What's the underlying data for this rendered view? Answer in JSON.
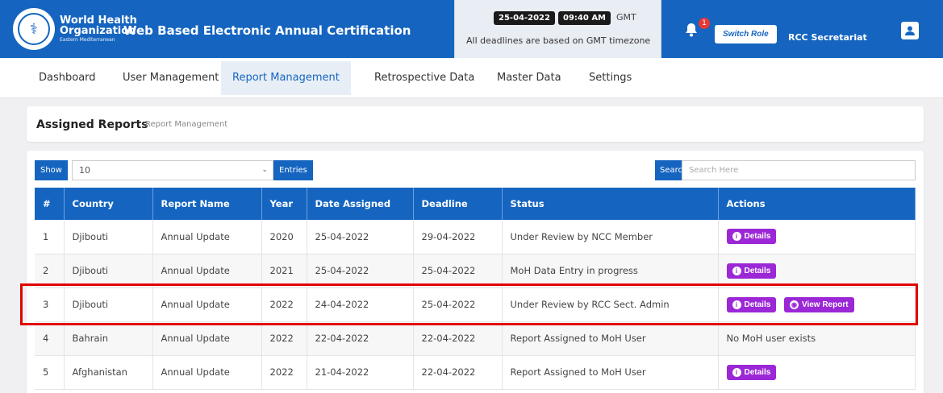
{
  "header": {
    "org_line1": "World Health",
    "org_line2": "Organization",
    "org_line3": "Eastern Mediterranean",
    "app_title": "Web Based Electronic Annual Certification",
    "date": "25-04-2022",
    "time": "09:40 AM",
    "tz": "GMT",
    "tz_note": "All deadlines are based on GMT timezone",
    "notification_count": "1",
    "switch_role": "Switch Role",
    "user_name": "RCC Secretariat",
    "brand_color": "#1565c0"
  },
  "nav": {
    "items": [
      {
        "label": "Dashboard"
      },
      {
        "label": "User Management"
      },
      {
        "label": "Report Management"
      },
      {
        "label": "Retrospective Data"
      },
      {
        "label": "Master Data"
      },
      {
        "label": "Settings"
      }
    ],
    "active": "Report Management"
  },
  "breadcrumb": {
    "title": "Assigned Reports",
    "sub": "Report Management"
  },
  "table_controls": {
    "show_label": "Show",
    "entries_value": "10",
    "entries_label": "Entries",
    "search_label": "Search:",
    "search_placeholder": "Search Here"
  },
  "table": {
    "headers": [
      "#",
      "Country",
      "Report Name",
      "Year",
      "Date Assigned",
      "Deadline",
      "Status",
      "Actions"
    ],
    "rows": [
      {
        "num": "1",
        "country": "Djibouti",
        "report": "Annual Update",
        "year": "2020",
        "assigned": "25-04-2022",
        "deadline": "29-04-2022",
        "status": "Under Review by NCC Member",
        "details": "Details"
      },
      {
        "num": "2",
        "country": "Djibouti",
        "report": "Annual Update",
        "year": "2021",
        "assigned": "25-04-2022",
        "deadline": "25-04-2022",
        "status": "MoH Data Entry in progress",
        "details": "Details"
      },
      {
        "num": "3",
        "country": "Djibouti",
        "report": "Annual Update",
        "year": "2022",
        "assigned": "24-04-2022",
        "deadline": "25-04-2022",
        "status": "Under Review by RCC Sect. Admin",
        "details": "Details",
        "view": "View Report"
      },
      {
        "num": "4",
        "country": "Bahrain",
        "report": "Annual Update",
        "year": "2022",
        "assigned": "22-04-2022",
        "deadline": "22-04-2022",
        "status": "Report Assigned to MoH User",
        "action_text": "No MoH user exists"
      },
      {
        "num": "5",
        "country": "Afghanistan",
        "report": "Annual Update",
        "year": "2022",
        "assigned": "21-04-2022",
        "deadline": "22-04-2022",
        "status": "Report Assigned to MoH User",
        "details": "Details"
      }
    ]
  },
  "colors": {
    "action_button": "#9b27d6",
    "highlight": "#e10000"
  },
  "icons": [
    "who-emblem-icon",
    "bell-icon",
    "user-icon",
    "info-icon",
    "eye-icon",
    "chevron-down-icon"
  ]
}
